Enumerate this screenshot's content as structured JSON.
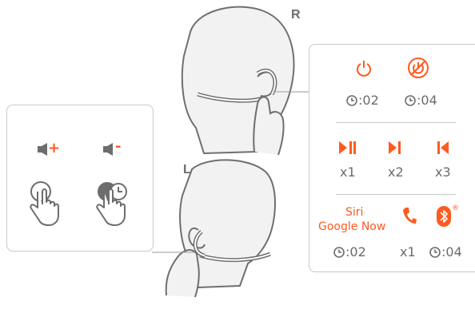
{
  "labels": {
    "right_side": "R",
    "left_side": "L"
  },
  "volume": {
    "up_symbol": "+",
    "down_symbol": "-"
  },
  "right_controls": {
    "power_on_time": ":02",
    "power_off_time": ":04",
    "play_pause_count": "x1",
    "next_track_count": "x2",
    "previous_track_count": "x3",
    "assistant_line1": "Siri",
    "assistant_line2": "Google Now",
    "assistant_time": ":02",
    "call_count": "x1",
    "bluetooth_time": ":04",
    "registered_mark": "®"
  },
  "colors": {
    "accent": "#ff5a1f",
    "icon_gray": "#6d6d6d",
    "line_gray": "#c9c9c9"
  }
}
